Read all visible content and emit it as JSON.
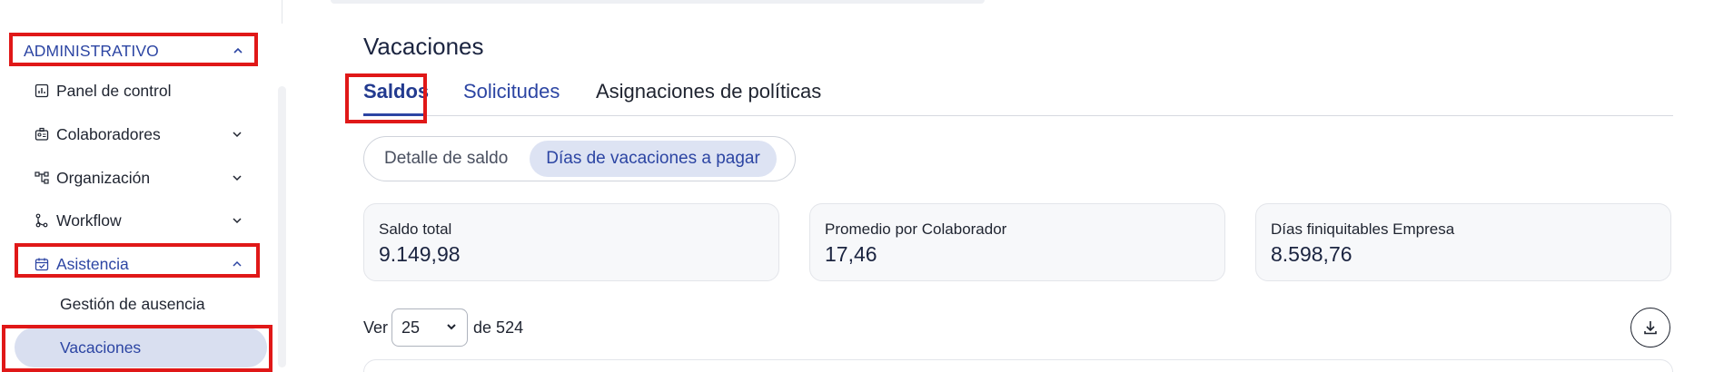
{
  "sidebar": {
    "section_label": "ADMINISTRATIVO",
    "items": [
      {
        "label": "Panel de control",
        "icon": "bar-chart-icon"
      },
      {
        "label": "Colaboradores",
        "icon": "people-card-icon"
      },
      {
        "label": "Organización",
        "icon": "org-chart-icon"
      },
      {
        "label": "Workflow",
        "icon": "workflow-icon"
      },
      {
        "label": "Asistencia",
        "icon": "calendar-check-icon"
      }
    ],
    "subitems": [
      {
        "label": "Gestión de ausencia"
      },
      {
        "label": "Vacaciones"
      }
    ]
  },
  "page": {
    "title": "Vacaciones"
  },
  "tabs": [
    {
      "label": "Saldos"
    },
    {
      "label": "Solicitudes"
    },
    {
      "label": "Asignaciones de políticas"
    }
  ],
  "segmented": {
    "options": [
      "Detalle de saldo",
      "Días de vacaciones a pagar"
    ],
    "selected": "Días de vacaciones a pagar"
  },
  "cards": [
    {
      "label": "Saldo total",
      "value": "9.149,98"
    },
    {
      "label": "Promedio por Colaborador",
      "value": "17,46"
    },
    {
      "label": "Días finiquitables Empresa",
      "value": "8.598,76"
    }
  ],
  "pager": {
    "prefix": "Ver",
    "page_size": "25",
    "suffix": "de 524"
  },
  "colors": {
    "accent": "#2c45a3",
    "highlight": "#e01818",
    "active_bg": "#d9dff0"
  }
}
